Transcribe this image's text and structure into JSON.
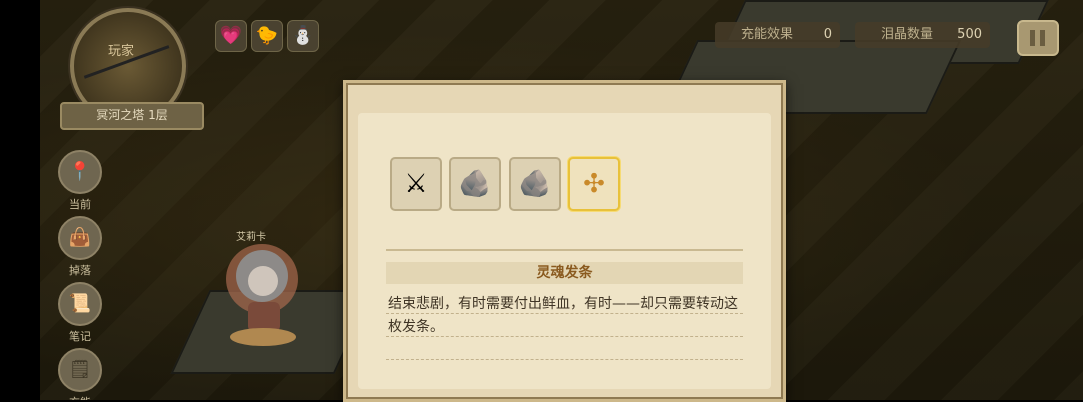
{
  "minimap": {
    "label": "玩家"
  },
  "floor": {
    "name": "冥河之塔 1层"
  },
  "side_menu": [
    {
      "label": "当前",
      "icon": "pin-icon",
      "glyph": "📍"
    },
    {
      "label": "掉落",
      "icon": "bag-icon",
      "glyph": "👜"
    },
    {
      "label": "笔记",
      "icon": "notes-icon",
      "glyph": "📜"
    },
    {
      "label": "充能",
      "icon": "charge-icon",
      "glyph": "🗒"
    }
  ],
  "top_icons": [
    {
      "name": "heart-potion-icon",
      "glyph": "💗"
    },
    {
      "name": "yellow-bird-icon",
      "glyph": "🐤"
    },
    {
      "name": "snowman-icon",
      "glyph": "⛄"
    }
  ],
  "stats": {
    "charge_effect_label": "充能效果",
    "charge_effect_value": "0",
    "tear_crystal_label": "泪晶数量",
    "tear_crystal_value": "500"
  },
  "character": {
    "name": "艾莉卡"
  },
  "dialog": {
    "items": [
      {
        "name": "scythe-item-icon",
        "glyph": "⚔"
      },
      {
        "name": "stone-item-icon",
        "glyph": "🪨"
      },
      {
        "name": "stone-item-icon-2",
        "glyph": "🪨"
      },
      {
        "name": "hairpin-item-icon",
        "glyph": "✣"
      }
    ],
    "selected_index": 3,
    "item_title": "灵魂发条",
    "desc_line1": "结束悲剧，有时需要付出鲜血，有时——却只需要转动这",
    "desc_line2": "枚发条。"
  }
}
